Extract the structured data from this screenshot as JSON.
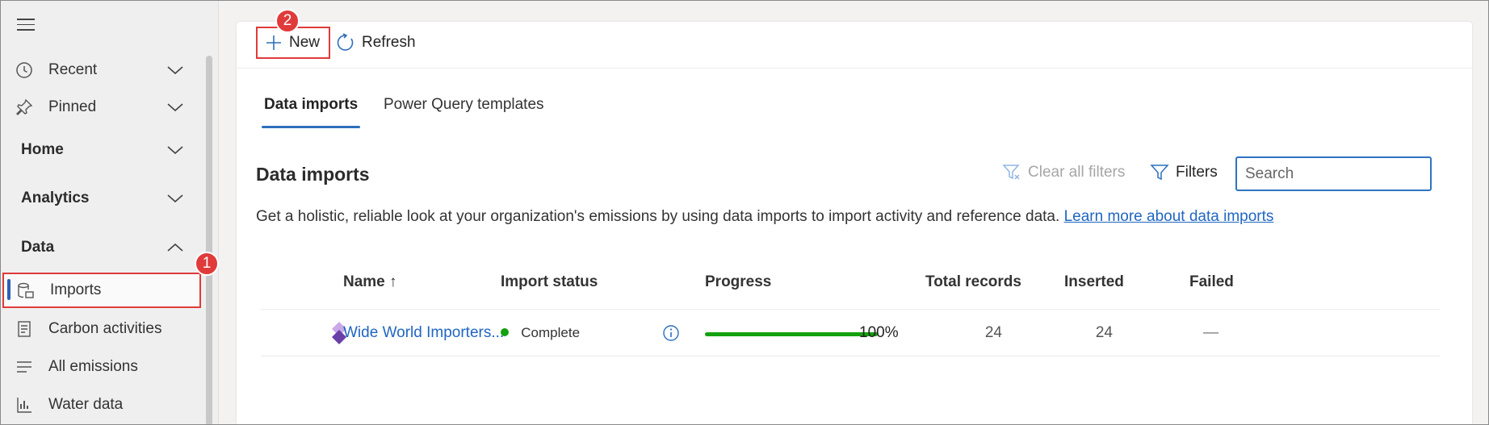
{
  "sidebar": {
    "recent": "Recent",
    "pinned": "Pinned",
    "home": "Home",
    "analytics": "Analytics",
    "data": "Data",
    "imports": "Imports",
    "carbon": "Carbon activities",
    "emissions": "All emissions",
    "water": "Water data"
  },
  "annotations": {
    "step1": "1",
    "step2": "2"
  },
  "commandbar": {
    "new_label": "New",
    "refresh_label": "Refresh"
  },
  "tabs": {
    "data_imports": "Data imports",
    "pq_templates": "Power Query templates"
  },
  "section": {
    "title": "Data imports",
    "clear_filters": "Clear all filters",
    "filters": "Filters",
    "search_placeholder": "Search",
    "description": "Get a holistic, reliable look at your organization's emissions by using data imports to import activity and reference data.",
    "learn_more": "Learn more about data imports"
  },
  "table": {
    "columns": {
      "name": "Name ↑",
      "status": "Import status",
      "progress": "Progress",
      "total": "Total records",
      "inserted": "Inserted",
      "failed": "Failed"
    },
    "rows": [
      {
        "name": "Wide World Importers...",
        "status": "Complete",
        "progress_label": "100%",
        "progress_value": 100,
        "total": "24",
        "inserted": "24",
        "failed": "—"
      }
    ]
  },
  "colors": {
    "accent": "#2c6fbb",
    "link": "#1f66c1",
    "annotation_red": "#e03a3a",
    "status_green": "#13a10e"
  },
  "icons": {
    "recent": "clock-icon",
    "pinned": "pin-icon",
    "imports": "database-icon",
    "carbon": "document-icon",
    "emissions": "list-icon",
    "water": "chart-icon",
    "new": "plus-icon",
    "refresh": "refresh-icon",
    "clear_filters": "filter-clear-icon",
    "filters": "filter-icon",
    "info": "info-icon",
    "row_entity": "data-import-icon"
  }
}
